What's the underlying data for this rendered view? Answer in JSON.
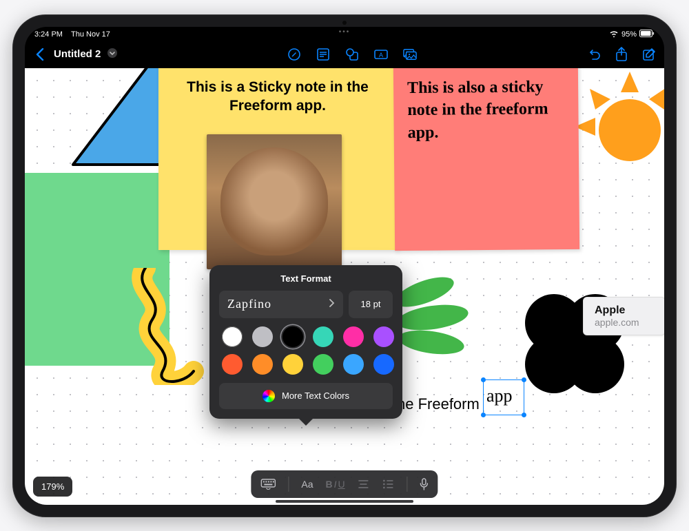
{
  "status": {
    "time": "3:24 PM",
    "date": "Thu Nov 17",
    "battery": "95%"
  },
  "nav": {
    "back_icon": "chevron-left",
    "title": "Untitled 2",
    "tools": [
      "draw",
      "sticky-note",
      "shapes",
      "text-box",
      "media"
    ],
    "right": [
      "undo",
      "share",
      "compose"
    ]
  },
  "canvas": {
    "sticky_yellow_text": "This is a Sticky note in the Freeform app.",
    "sticky_pink_text": "This is also a sticky note in the freeform app.",
    "bottom_text_prefix": "he Freeform ",
    "selected_word": "app",
    "link": {
      "title": "Apple",
      "url": "apple.com"
    }
  },
  "popover": {
    "title": "Text Format",
    "font_name": "Zapfino",
    "font_size": "18 pt",
    "colors": [
      {
        "hex": "#ffffff",
        "name": "white"
      },
      {
        "hex": "#bfbfc4",
        "name": "gray"
      },
      {
        "hex": "#000000",
        "name": "black",
        "selected": true
      },
      {
        "hex": "#36d6b7",
        "name": "teal"
      },
      {
        "hex": "#ff2ea6",
        "name": "pink"
      },
      {
        "hex": "#a950ff",
        "name": "purple"
      },
      {
        "hex": "#ff5b30",
        "name": "red"
      },
      {
        "hex": "#ff8d28",
        "name": "orange"
      },
      {
        "hex": "#ffd23a",
        "name": "yellow"
      },
      {
        "hex": "#43cf5e",
        "name": "green"
      },
      {
        "hex": "#3aa6ff",
        "name": "light-blue"
      },
      {
        "hex": "#1769ff",
        "name": "blue"
      }
    ],
    "more_label": "More Text Colors"
  },
  "kbbar": {
    "font_style": "Aa",
    "biu": "BIU"
  },
  "zoom": "179%"
}
